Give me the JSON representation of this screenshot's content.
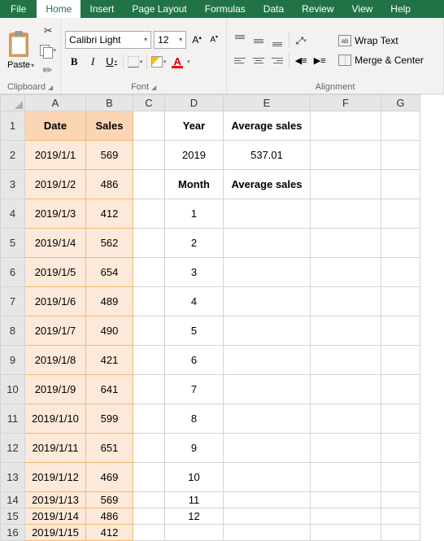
{
  "tabs": {
    "file": "File",
    "home": "Home",
    "insert": "Insert",
    "pagelayout": "Page Layout",
    "formulas": "Formulas",
    "data": "Data",
    "review": "Review",
    "view": "View",
    "help": "Help"
  },
  "ribbon": {
    "clipboard": {
      "paste": "Paste",
      "label": "Clipboard"
    },
    "font": {
      "name": "Calibri Light",
      "size": "12",
      "label": "Font",
      "bold": "B",
      "italic": "I",
      "underline": "U",
      "fontcolor": "A"
    },
    "alignment": {
      "label": "Alignment",
      "wrap": "Wrap Text",
      "merge": "Merge & Center",
      "ab": "ab"
    }
  },
  "cols": [
    "A",
    "B",
    "C",
    "D",
    "E",
    "F",
    "G"
  ],
  "headers": {
    "date": "Date",
    "sales": "Sales",
    "year": "Year",
    "avgsales": "Average sales",
    "month": "Month"
  },
  "yearval": "2019",
  "avgval": "537.01",
  "rows": [
    {
      "n": "1",
      "h": 36,
      "a": "Date",
      "b": "Sales",
      "d": "Year",
      "e": "Average sales",
      "hdr": true
    },
    {
      "n": "2",
      "h": 36,
      "a": "2019/1/1",
      "b": "569",
      "d": "2019",
      "e": "537.01"
    },
    {
      "n": "3",
      "h": 36,
      "a": "2019/1/2",
      "b": "486",
      "d": "Month",
      "e": "Average sales",
      "dhdr": true
    },
    {
      "n": "4",
      "h": 36,
      "a": "2019/1/3",
      "b": "412",
      "d": "1"
    },
    {
      "n": "5",
      "h": 36,
      "a": "2019/1/4",
      "b": "562",
      "d": "2"
    },
    {
      "n": "6",
      "h": 36,
      "a": "2019/1/5",
      "b": "654",
      "d": "3"
    },
    {
      "n": "7",
      "h": 36,
      "a": "2019/1/6",
      "b": "489",
      "d": "4"
    },
    {
      "n": "8",
      "h": 36,
      "a": "2019/1/7",
      "b": "490",
      "d": "5"
    },
    {
      "n": "9",
      "h": 36,
      "a": "2019/1/8",
      "b": "421",
      "d": "6"
    },
    {
      "n": "10",
      "h": 36,
      "a": "2019/1/9",
      "b": "641",
      "d": "7"
    },
    {
      "n": "11",
      "h": 36,
      "a": "2019/1/10",
      "b": "599",
      "d": "8"
    },
    {
      "n": "12",
      "h": 36,
      "a": "2019/1/11",
      "b": "651",
      "d": "9"
    },
    {
      "n": "13",
      "h": 36,
      "a": "2019/1/12",
      "b": "469",
      "d": "10"
    },
    {
      "n": "14",
      "h": 20,
      "a": "2019/1/13",
      "b": "569",
      "d": "11"
    },
    {
      "n": "15",
      "h": 20,
      "a": "2019/1/14",
      "b": "486",
      "d": "12"
    },
    {
      "n": "16",
      "h": 20,
      "a": "2019/1/15",
      "b": "412"
    }
  ]
}
